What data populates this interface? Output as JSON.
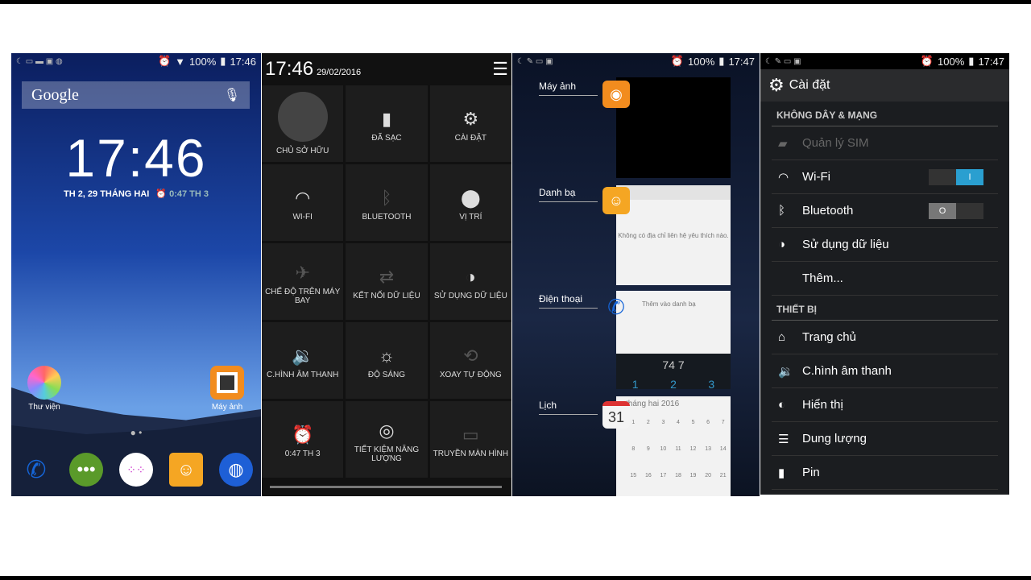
{
  "home": {
    "status_time": "17:46",
    "battery": "100%",
    "search_label": "Google",
    "clock": "17:46",
    "date": "TH 2, 29 THÁNG HAI",
    "alarm": "0:47 TH 3",
    "apps": [
      {
        "label": "Thư viện",
        "icon": "gallery-icon"
      },
      {
        "label": "Máy ảnh",
        "icon": "camera-icon"
      }
    ],
    "dock": [
      "phone-icon",
      "messaging-icon",
      "app-drawer-icon",
      "contacts-icon",
      "browser-icon"
    ]
  },
  "quick": {
    "time": "17:46",
    "date": "29/02/2016",
    "tiles": [
      {
        "label": "CHỦ SỞ HỮU",
        "icon": "user-icon"
      },
      {
        "label": "ĐÃ SẠC",
        "icon": "battery-icon"
      },
      {
        "label": "CÀI ĐẶT",
        "icon": "gear-icon"
      },
      {
        "label": "WI-FI",
        "icon": "wifi-icon"
      },
      {
        "label": "BLUETOOTH",
        "icon": "bluetooth-icon",
        "dim": true
      },
      {
        "label": "VỊ TRÍ",
        "icon": "location-icon"
      },
      {
        "label": "CHẾ ĐỘ TRÊN MÁY BAY",
        "icon": "airplane-icon",
        "dim": true
      },
      {
        "label": "KẾT NỐI DỮ LIỆU",
        "icon": "data-connection-icon",
        "dim": true
      },
      {
        "label": "SỬ DỤNG DỮ LIỆU",
        "icon": "data-usage-icon"
      },
      {
        "label": "C.HÌNH ÂM THANH",
        "icon": "sound-profile-icon",
        "dim": true
      },
      {
        "label": "ĐỘ SÁNG",
        "icon": "brightness-icon"
      },
      {
        "label": "XOAY TỰ ĐỘNG",
        "icon": "rotate-icon",
        "dim": true
      },
      {
        "label": "0:47 TH 3",
        "icon": "alarm-icon"
      },
      {
        "label": "TIẾT KIỆM NĂNG LƯỢNG",
        "icon": "power-saving-icon"
      },
      {
        "label": "TRUYỀN MÀN HÌNH",
        "icon": "cast-icon",
        "dim": true
      }
    ]
  },
  "recents": {
    "status_time": "17:47",
    "battery": "100%",
    "apps": [
      {
        "label": "Máy ảnh"
      },
      {
        "label": "Danh bạ",
        "content": "Không có địa chỉ liên hệ yêu thích nào."
      },
      {
        "label": "Điện thoại",
        "content": "Thêm vào danh bạ",
        "dial": "74 7",
        "keys": [
          "1",
          "2",
          "3"
        ]
      },
      {
        "label": "Lịch",
        "content": "tháng hai 2016",
        "cal_icon": "31",
        "days": [
          "1",
          "2",
          "3",
          "4",
          "5",
          "6",
          "7",
          "8",
          "9",
          "10",
          "11",
          "12",
          "13",
          "14",
          "15",
          "16",
          "17",
          "18",
          "19",
          "20",
          "21"
        ]
      }
    ]
  },
  "settings": {
    "status_time": "17:47",
    "battery": "100%",
    "title": "Cài đặt",
    "section1": "KHÔNG DÂY & MẠNG",
    "items1": [
      {
        "label": "Quản lý SIM",
        "icon": "sim-icon",
        "disabled": true
      },
      {
        "label": "Wi-Fi",
        "icon": "wifi-icon",
        "toggle": "on"
      },
      {
        "label": "Bluetooth",
        "icon": "bluetooth-icon",
        "toggle": "off"
      },
      {
        "label": "Sử dụng dữ liệu",
        "icon": "data-usage-icon"
      },
      {
        "label": "Thêm...",
        "icon": ""
      }
    ],
    "section2": "THIẾT BỊ",
    "items2": [
      {
        "label": "Trang chủ",
        "icon": "home-icon"
      },
      {
        "label": "C.hình âm thanh",
        "icon": "sound-profile-icon"
      },
      {
        "label": "Hiển thị",
        "icon": "display-icon"
      },
      {
        "label": "Dung lượng",
        "icon": "storage-icon"
      },
      {
        "label": "Pin",
        "icon": "battery-icon"
      }
    ],
    "accent": "#2a9fd0"
  }
}
